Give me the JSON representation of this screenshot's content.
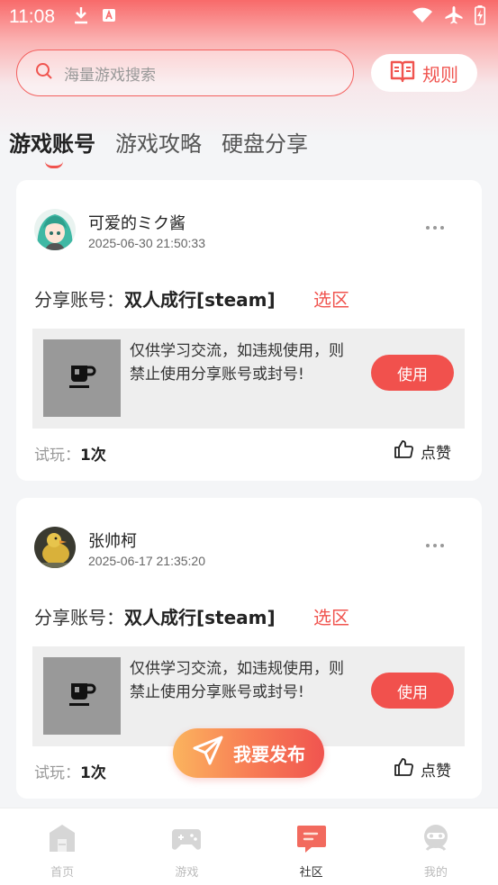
{
  "status_bar": {
    "time": "11:08"
  },
  "search": {
    "placeholder": "海量游戏搜索"
  },
  "rules": {
    "label": "规则"
  },
  "tabs": [
    {
      "label": "游戏账号",
      "active": true
    },
    {
      "label": "游戏攻略",
      "active": false
    },
    {
      "label": "硬盘分享",
      "active": false
    }
  ],
  "posts": [
    {
      "username": "可爱的ミク酱",
      "time": "2025-06-30 21:50:33",
      "share_label": "分享账号：",
      "share_value": "双人成行[steam]",
      "region": "选区",
      "notice": "仅供学习交流，如违规使用，则禁止使用分享账号或封号!",
      "use_label": "使用",
      "trial_label": "试玩：",
      "trial_count": "1次",
      "like_label": "点赞"
    },
    {
      "username": "张帅柯",
      "time": "2025-06-17 21:35:20",
      "share_label": "分享账号：",
      "share_value": "双人成行[steam]",
      "region": "选区",
      "notice": "仅供学习交流，如违规使用，则禁止使用分享账号或封号!",
      "use_label": "使用",
      "trial_label": "试玩：",
      "trial_count": "1次",
      "like_label": "点赞"
    }
  ],
  "publish": {
    "label": "我要发布"
  },
  "bottom_nav": [
    {
      "label": "首页",
      "icon": "home-icon",
      "active": false
    },
    {
      "label": "游戏",
      "icon": "gamepad-icon",
      "active": false
    },
    {
      "label": "社区",
      "icon": "community-icon",
      "active": true
    },
    {
      "label": "我的",
      "icon": "profile-icon",
      "active": false
    }
  ],
  "colors": {
    "accent": "#f0544f",
    "background": "#f4f5f7"
  }
}
